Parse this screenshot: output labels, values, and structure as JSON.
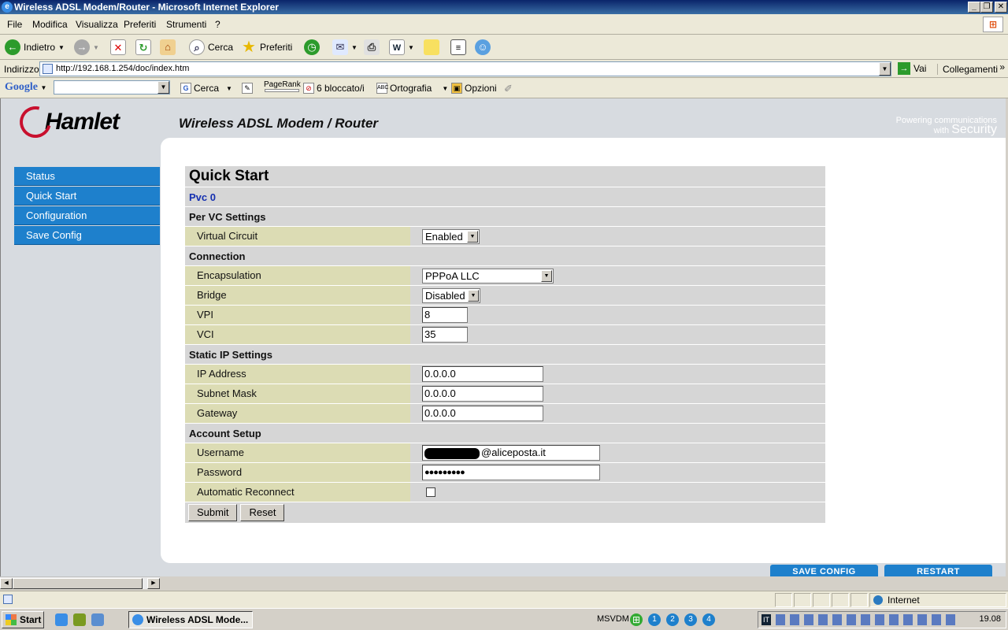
{
  "window": {
    "title": "Wireless ADSL Modem/Router - Microsoft Internet Explorer"
  },
  "menu": [
    "File",
    "Modifica",
    "Visualizza",
    "Preferiti",
    "Strumenti",
    "?"
  ],
  "toolbar": {
    "back": "Indietro",
    "search": "Cerca",
    "favorites": "Preferiti"
  },
  "address": {
    "label": "Indirizzo",
    "url": "http://192.168.1.254/doc/index.htm",
    "go": "Vai",
    "links": "Collegamenti"
  },
  "googlebar": {
    "logo": "Google",
    "search": "Cerca",
    "pagerank": "PageRank",
    "blocked": "6 bloccato/i",
    "spell": "Ortografia",
    "options": "Opzioni"
  },
  "page": {
    "brand": "Hamlet",
    "product": "Wireless ADSL Modem / Router",
    "tagline_1": "Powering communications",
    "tagline_2": "with",
    "tagline_3": "Security",
    "nav": [
      "Status",
      "Quick Start",
      "Configuration",
      "Save Config"
    ],
    "form": {
      "title": "Quick Start",
      "pvc": "Pvc 0",
      "sec_vc": "Per VC Settings",
      "virtual_circuit_label": "Virtual Circuit",
      "virtual_circuit_value": "Enabled",
      "sec_conn": "Connection",
      "encap_label": "Encapsulation",
      "encap_value": "PPPoA LLC",
      "bridge_label": "Bridge",
      "bridge_value": "Disabled",
      "vpi_label": "VPI",
      "vpi_value": "8",
      "vci_label": "VCI",
      "vci_value": "35",
      "sec_static": "Static IP Settings",
      "ip_label": "IP Address",
      "ip_value": "0.0.0.0",
      "mask_label": "Subnet Mask",
      "mask_value": "0.0.0.0",
      "gw_label": "Gateway",
      "gw_value": "0.0.0.0",
      "sec_account": "Account Setup",
      "user_label": "Username",
      "user_value": "@aliceposta.it",
      "pass_label": "Password",
      "pass_value": "●●●●●●●●●",
      "reconnect_label": "Automatic Reconnect",
      "reconnect_checked": false,
      "submit": "Submit",
      "reset": "Reset"
    },
    "save_config": "SAVE CONFIG",
    "restart": "RESTART"
  },
  "status": {
    "zone": "Internet"
  },
  "taskbar": {
    "start": "Start",
    "task": "Wireless ADSL Mode...",
    "msvdm": "MSVDM",
    "desktops": [
      "1",
      "2",
      "3",
      "4"
    ],
    "clock": "19.08"
  }
}
